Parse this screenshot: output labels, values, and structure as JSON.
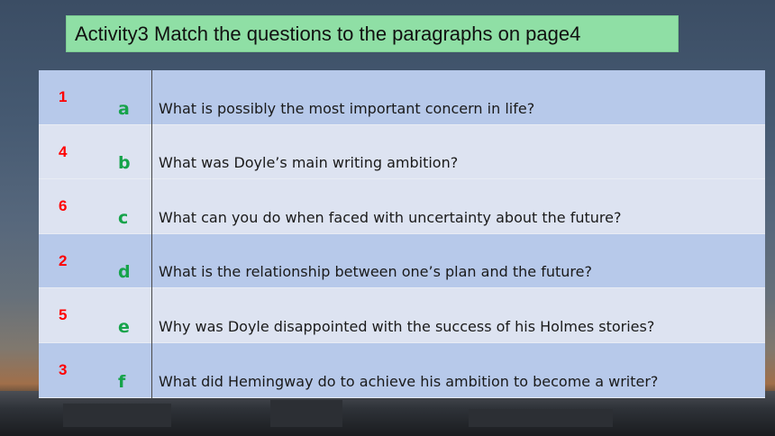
{
  "title": "Activity3 Match the questions to the paragraphs on page4",
  "rows": [
    {
      "number": "1",
      "letter": "a",
      "question": "What is possibly the most important concern in life?"
    },
    {
      "number": "4",
      "letter": "b",
      "question": "What was Doyle’s main writing ambition?"
    },
    {
      "number": "6",
      "letter": "c",
      "question": "What can you do when faced with uncertainty about the future?"
    },
    {
      "number": "2",
      "letter": "d",
      "question": "What is the relationship between one’s plan and the future?"
    },
    {
      "number": "5",
      "letter": "e",
      "question": "Why was Doyle disappointed with the success of his Holmes stories?"
    },
    {
      "number": "3",
      "letter": "f",
      "question": "What did Hemingway do to achieve his ambition to become a writer?"
    }
  ],
  "colors": {
    "number": "#ff0000",
    "letter": "#16a34a",
    "title_bg": "#8fdfa5",
    "row_dark": "#b7c9ea",
    "row_light": "#dde3f1"
  }
}
